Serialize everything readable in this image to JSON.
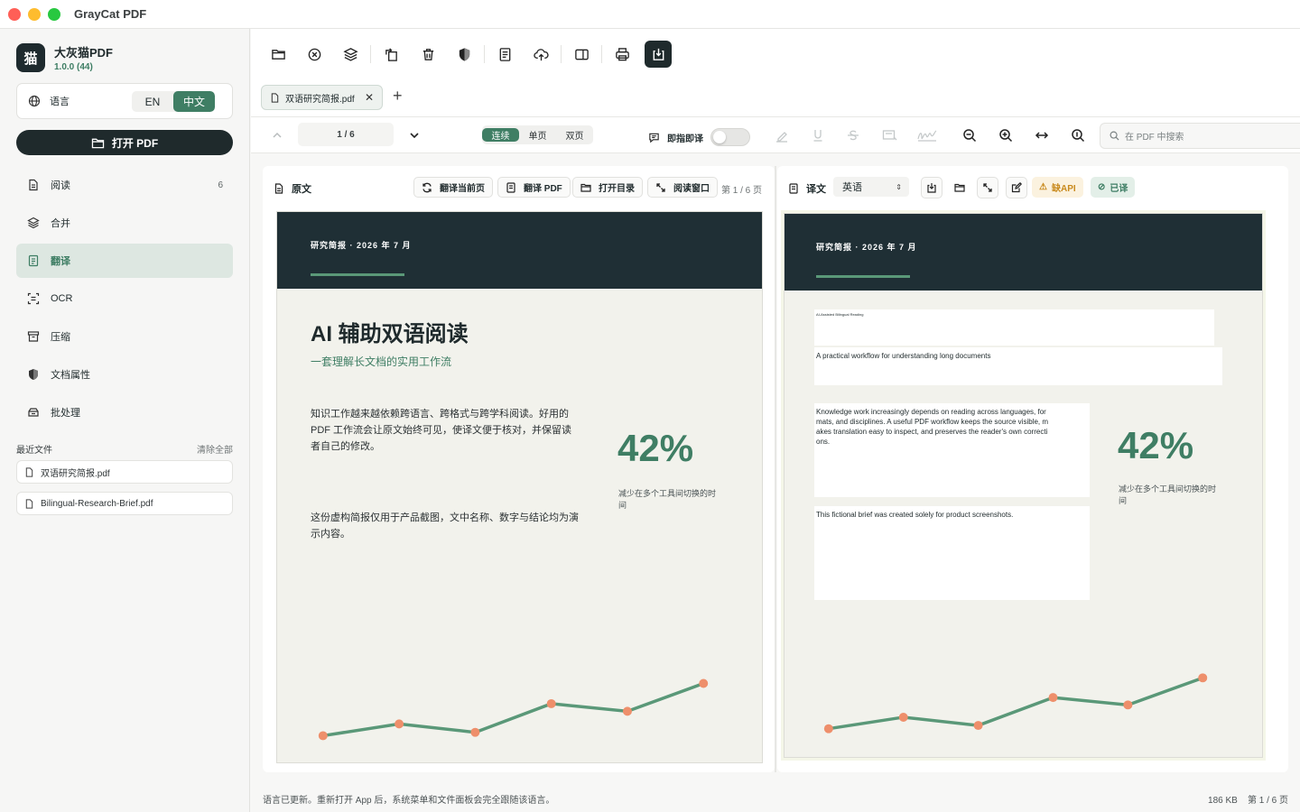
{
  "app": {
    "title": "GrayCat PDF",
    "name": "大灰猫PDF",
    "version": "1.0.0 (44)",
    "logo_glyph": "猫",
    "accent": "#3f7e64",
    "dark": "#1f2a2c"
  },
  "sidebar": {
    "language_label": "语言",
    "lang_en": "EN",
    "lang_zh": "中文",
    "open_button": "打开 PDF",
    "items": [
      {
        "label": "阅读",
        "count": "6",
        "icon": "document-icon"
      },
      {
        "label": "合并",
        "icon": "layers-icon"
      },
      {
        "label": "翻译",
        "icon": "translate-icon",
        "active": true
      },
      {
        "label": "OCR",
        "icon": "scan-icon"
      },
      {
        "label": "压缩",
        "icon": "archive-icon"
      },
      {
        "label": "文档属性",
        "icon": "shield-icon"
      },
      {
        "label": "批处理",
        "icon": "batch-icon"
      }
    ],
    "recent_title": "最近文件",
    "recent_clear": "清除全部",
    "recent_files": [
      "双语研究简报.pdf",
      "Bilingual-Research-Brief.pdf"
    ]
  },
  "tab": {
    "label": "双语研究简报.pdf"
  },
  "viewbar": {
    "page": "1 / 6",
    "mode_continuous": "连续",
    "mode_single": "单页",
    "mode_double": "双页",
    "instant_translate": "即指即译",
    "search_placeholder": "在 PDF 中搜索"
  },
  "left_pane": {
    "title": "原文",
    "btn_translate_page": "翻译当前页",
    "btn_translate_pdf": "翻译 PDF",
    "btn_open_toc": "打开目录",
    "btn_reading_window": "阅读窗口",
    "page_indicator": "第 1 / 6 页"
  },
  "right_pane": {
    "title": "译文",
    "language": "英语",
    "missing_api": "缺API",
    "translated": "已译"
  },
  "original_doc": {
    "kicker": "研究简报 · 2026 年 7 月",
    "title": "AI 辅助双语阅读",
    "subtitle": "一套理解长文档的实用工作流",
    "para1_l1": "知识工作越来越依赖跨语言、跨格式与跨学科阅读。好用的",
    "para1_l2": "PDF 工作流会让原文始终可见，使译文便于核对，并保留读",
    "para1_l3": "者自己的修改。",
    "para2_l1": "这份虚构简报仅用于产品截图，文中名称、数字与结论均为演",
    "para2_l2": "示内容。",
    "big_stat": "42%",
    "stat_caption_l1": "减少在多个工具间切换的时",
    "stat_caption_l2": "间"
  },
  "translated_doc": {
    "kicker": "研究简报 · 2026 年 7 月",
    "title_en": "AI-Assisted Bilingual Reading",
    "subtitle_en": "A practical workflow for understanding long documents",
    "para1_en_l1": "Knowledge work increasingly depends on reading across languages, for",
    "para1_en_l2": "mats, and disciplines. A useful PDF workflow keeps the source visible, m",
    "para1_en_l3": "akes translation easy to inspect, and preserves the reader's own correcti",
    "para1_en_l4": "ons.",
    "para2_en": "This fictional brief was created solely for product screenshots.",
    "big_stat": "42%",
    "stat_caption_l1": "减少在多个工具间切换的时",
    "stat_caption_l2": "间"
  },
  "chart_data": {
    "type": "line",
    "x": [
      1,
      2,
      3,
      4,
      5,
      6
    ],
    "values": [
      1,
      2.4,
      1.4,
      4.8,
      3.9,
      7.2
    ],
    "ylim": [
      0,
      8
    ],
    "line_color": "#5a9878",
    "point_color": "#ee8f6b"
  },
  "status": {
    "message": "语言已更新。重新打开 App 后，系统菜单和文件面板会完全跟随该语言。",
    "size": "186 KB",
    "page": "第 1 / 6 页"
  }
}
